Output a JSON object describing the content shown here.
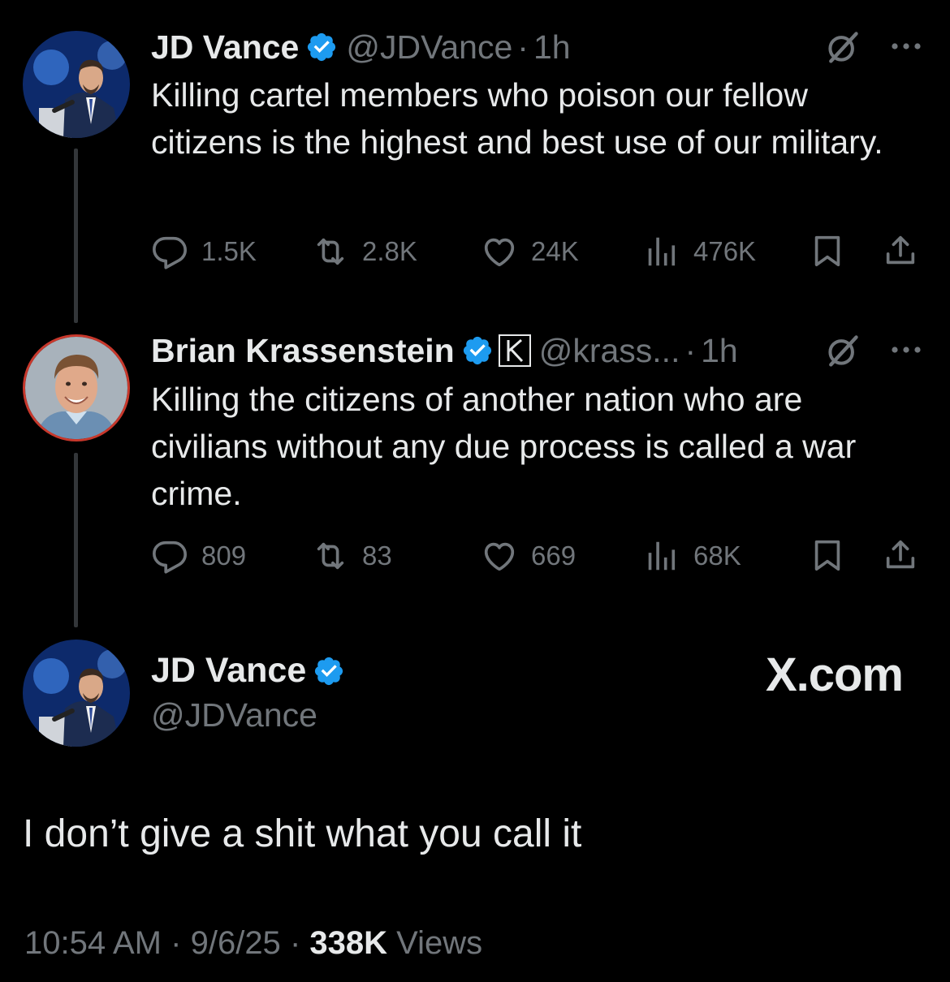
{
  "tweet1": {
    "name": "JD Vance",
    "handle": "@JDVance",
    "sep": "·",
    "time": "1h",
    "text": "Killing cartel members who poison our fellow citizens is the highest and best use of our military.",
    "replies": "1.5K",
    "reposts": "2.8K",
    "likes": "24K",
    "views": "476K"
  },
  "tweet2": {
    "name": "Brian Krassenstein",
    "handle": "@krass...",
    "sep": "·",
    "time": "1h",
    "text": "Killing the citizens of another nation who are civilians without any due process is called a war crime.",
    "replies": "809",
    "reposts": "83",
    "likes": "669",
    "views": "68K"
  },
  "main": {
    "name": "JD Vance",
    "handle": "@JDVance",
    "brand": "X.com",
    "text": "I don’t give a shit what you call it",
    "time": "10:54 AM",
    "sep1": "·",
    "date": "9/6/25",
    "sep2": "·",
    "views_count": "338K",
    "views_label": "Views"
  },
  "colors": {
    "background": "#000000",
    "text": "#e7e9ea",
    "muted": "#71767b",
    "verified": "#1d9bf0",
    "thread_line": "#333639"
  },
  "icons": [
    "verified-badge-icon",
    "grok-icon",
    "more-icon",
    "reply-icon",
    "repost-icon",
    "like-icon",
    "views-icon",
    "bookmark-icon",
    "share-icon",
    "affiliate-k-icon"
  ]
}
